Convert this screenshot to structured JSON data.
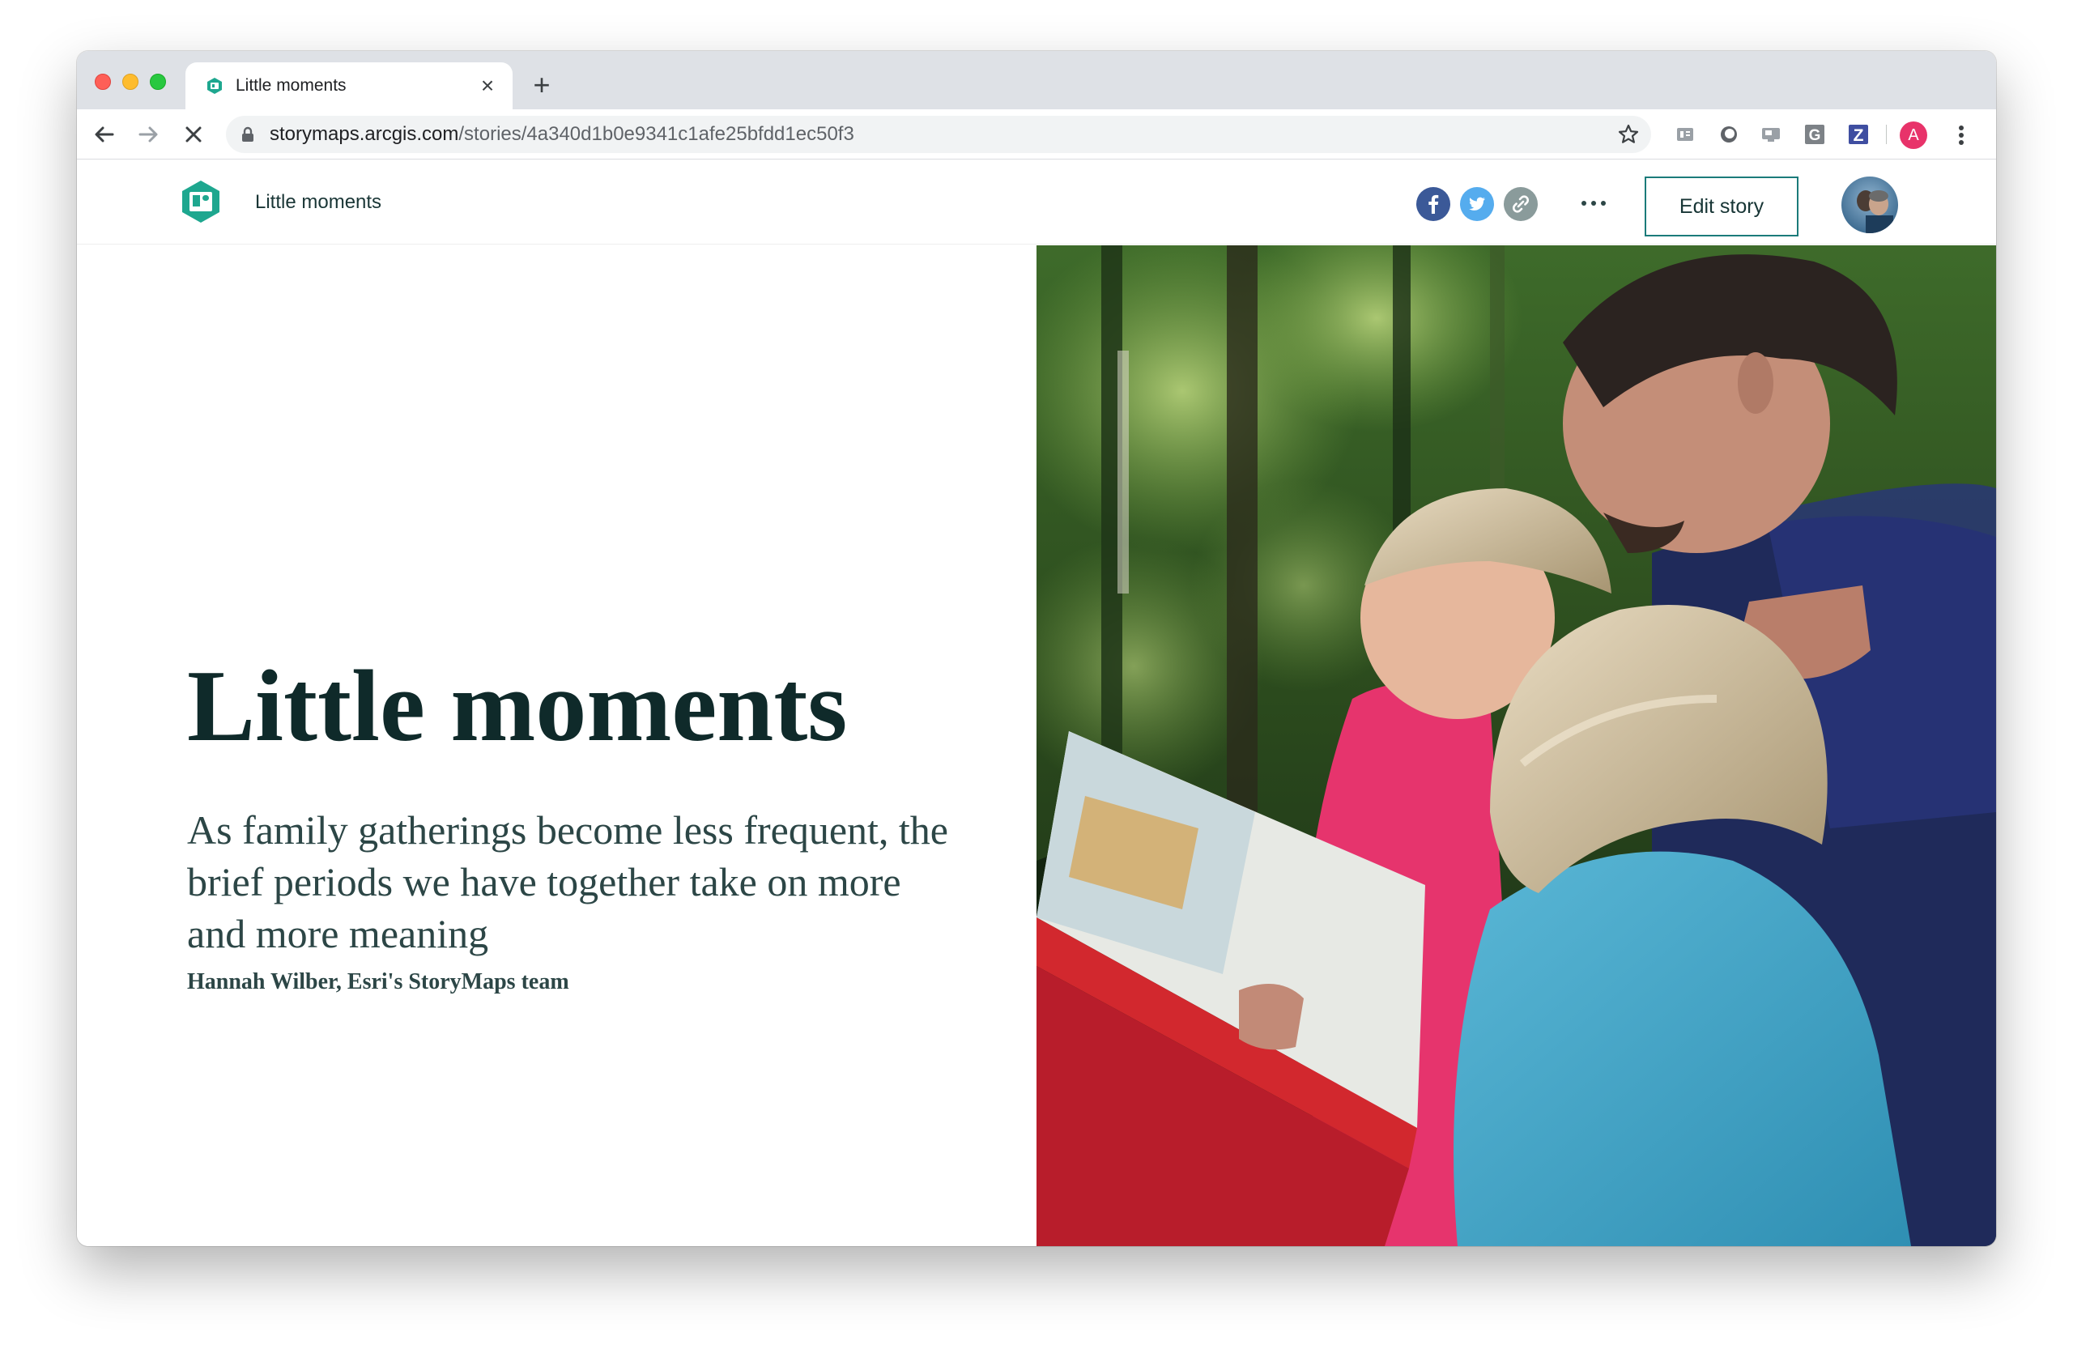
{
  "browser": {
    "tab": {
      "title": "Little moments",
      "close_glyph": "×",
      "favicon": "storymaps-favicon"
    },
    "new_tab_glyph": "+",
    "url": {
      "host": "storymaps.arcgis.com",
      "path": "/stories/4a340d1b0e9341c1afe25bfdd1ec50f3"
    },
    "extensions": [
      "reader-icon",
      "circle-extension-icon",
      "screen-icon",
      "grammarly-g-icon",
      "zotero-z-icon"
    ],
    "profile_initial": "A",
    "colors": {
      "profile": "#e8336a",
      "tabstrip": "#dee1e6"
    }
  },
  "header": {
    "story_title": "Little moments",
    "share": [
      "facebook-icon",
      "twitter-icon",
      "link-icon"
    ],
    "edit_label": "Edit story",
    "colors": {
      "logo": "#1ea78f",
      "facebook": "#3b5998",
      "twitter": "#55acee",
      "link": "#8a9b9b",
      "edit_border": "#1b7b7a"
    }
  },
  "cover": {
    "title": "Little moments",
    "subtitle": "As family gatherings become less frequent, the brief periods we have together take on more and more meaning",
    "byline": "Hannah Wilber, Esri's StoryMaps team",
    "image": "photo-father-reading-book-to-children-in-forest"
  }
}
